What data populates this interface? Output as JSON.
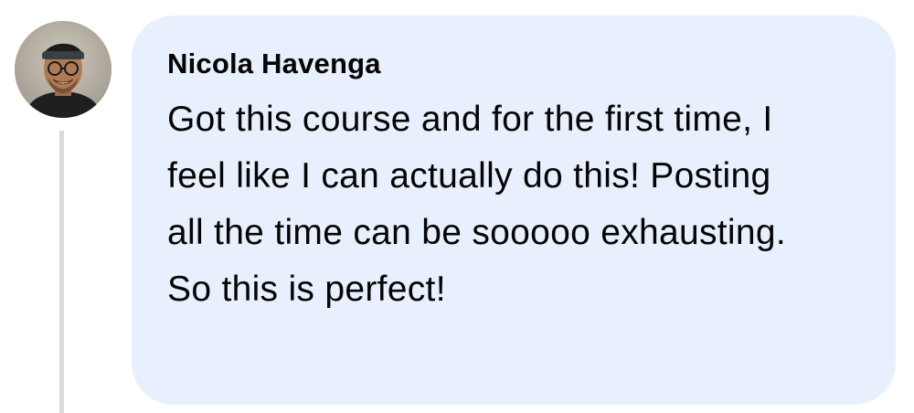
{
  "comment": {
    "author": "Nicola Havenga",
    "text": "Got this course and for the first time, I feel like I can actually do this! Posting all the time can be sooooo exhausting. So this is perfect!",
    "avatar_icon": "profile-photo"
  },
  "top_link_fragment": "· · · · ·",
  "colors": {
    "bubble_background": "#e7f0fc",
    "thread_line": "#d9dbdf",
    "text": "#050505",
    "link": "#385898"
  }
}
